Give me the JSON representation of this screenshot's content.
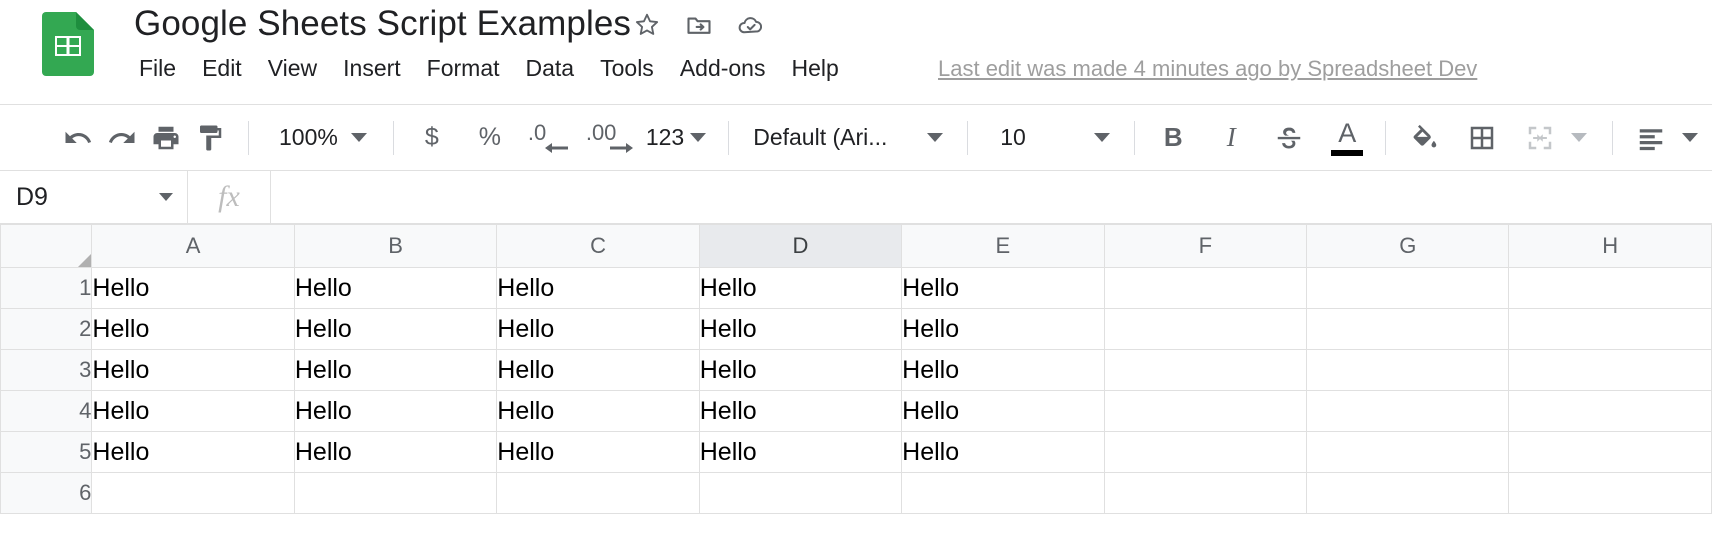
{
  "header": {
    "app_icon": "google-sheets-logo",
    "doc_title": "Google Sheets Script Examples",
    "title_icons": [
      {
        "name": "star-icon",
        "label": "Star"
      },
      {
        "name": "move-to-folder-icon",
        "label": "Move to folder"
      },
      {
        "name": "cloud-saved-icon",
        "label": "See document status"
      }
    ],
    "menus": [
      "File",
      "Edit",
      "View",
      "Insert",
      "Format",
      "Data",
      "Tools",
      "Add-ons",
      "Help"
    ],
    "last_edit": "Last edit was made 4 minutes ago by Spreadsheet Dev"
  },
  "toolbar": {
    "undo_label": "Undo",
    "redo_label": "Redo",
    "print_label": "Print",
    "paint_format_label": "Paint format",
    "zoom_value": "100%",
    "currency_label": "$",
    "percent_label": "%",
    "decrease_decimal_label": ".0",
    "increase_decimal_label": ".00",
    "number_format_label": "123",
    "font_value": "Default (Ari...",
    "font_size_value": "10",
    "bold_label": "B",
    "italic_label": "I",
    "strikethrough_label": "S",
    "text_color_label": "A",
    "fill_color_label": "Fill color",
    "borders_label": "Borders",
    "merge_cells_label": "Merge cells",
    "horizontal_align_label": "Horizontal align"
  },
  "formula_bar": {
    "name_box_value": "D9",
    "fx_label": "fx",
    "formula_value": "",
    "formula_placeholder": ""
  },
  "sheet": {
    "columns": [
      "A",
      "B",
      "C",
      "D",
      "E",
      "F",
      "G",
      "H"
    ],
    "active_column": "D",
    "rows": [
      "1",
      "2",
      "3",
      "4",
      "5",
      "6"
    ],
    "cells": [
      [
        "Hello",
        "Hello",
        "Hello",
        "Hello",
        "Hello",
        "",
        "",
        ""
      ],
      [
        "Hello",
        "Hello",
        "Hello",
        "Hello",
        "Hello",
        "",
        "",
        ""
      ],
      [
        "Hello",
        "Hello",
        "Hello",
        "Hello",
        "Hello",
        "",
        "",
        ""
      ],
      [
        "Hello",
        "Hello",
        "Hello",
        "Hello",
        "Hello",
        "",
        "",
        ""
      ],
      [
        "Hello",
        "Hello",
        "Hello",
        "Hello",
        "Hello",
        "",
        "",
        ""
      ],
      [
        "",
        "",
        "",
        "",
        "",
        "",
        "",
        ""
      ]
    ]
  },
  "colors": {
    "sheets_green": "#33a852",
    "icon_gray": "#5f6368",
    "header_bg": "#f8f9fa",
    "active_header_bg": "#e8eaed",
    "grid_line": "#e0e0e0",
    "muted_text": "#9e9e9e"
  }
}
